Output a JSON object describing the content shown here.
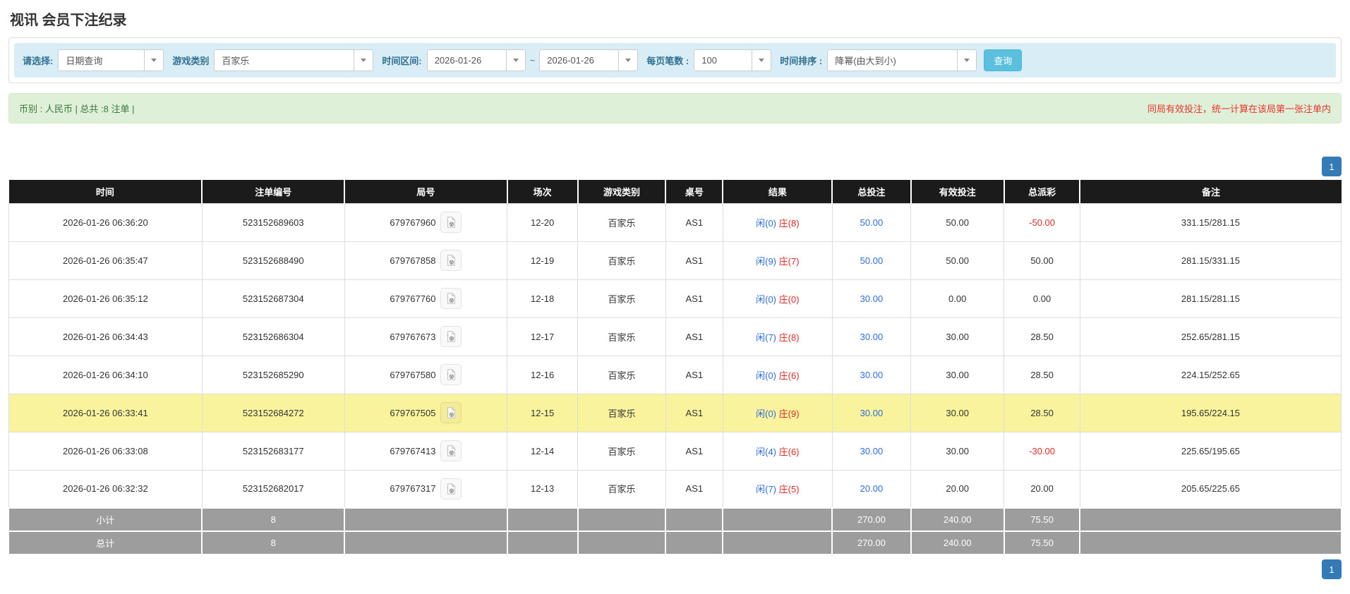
{
  "page": {
    "title": "视讯 会员下注纪录"
  },
  "filters": {
    "select_label": "请选择:",
    "select_value": "日期查询",
    "game_type_label": "游戏类别",
    "game_type_value": "百家乐",
    "time_range_label": "时间区间:",
    "date_from": "2026-01-26",
    "tilde": "~",
    "date_to": "2026-01-26",
    "page_size_label": "每页笔数 :",
    "page_size_value": "100",
    "sort_label": "时间排序 :",
    "sort_value": "降幂(由大到小)",
    "search_button": "查询"
  },
  "summary": {
    "left": "币别 : 人民币 | 总共 :8 注单 |",
    "right": "同局有效投注，统一计算在该局第一张注单内"
  },
  "pagination": {
    "page": "1"
  },
  "colors": {
    "header_bg": "#1b1b1b",
    "footer_bg": "#9d9d9d",
    "filter_bar_bg": "#d9edf7",
    "summary_bg": "#dff0d8",
    "highlight_row": "#f9f39d",
    "link_blue": "#2e6ddb",
    "result_red": "#e02a2a",
    "pagination_blue": "#337ab7",
    "search_button_bg": "#5bc0de",
    "warning_red": "#e9322d"
  },
  "table": {
    "headers": [
      "时间",
      "注单编号",
      "局号",
      "场次",
      "游戏类别",
      "桌号",
      "结果",
      "总投注",
      "有效投注",
      "总派彩",
      "备注"
    ],
    "rows": [
      {
        "time": "2026-01-26 06:36:20",
        "bet_id": "523152689603",
        "round_id": "679767960",
        "session": "12-20",
        "game": "百家乐",
        "table_no": "AS1",
        "player": "闲(0)",
        "banker": "庄(8)",
        "total_bet": "50.00",
        "valid_bet": "50.00",
        "payout": "-50.00",
        "remark": "331.15/281.15",
        "highlight": false
      },
      {
        "time": "2026-01-26 06:35:47",
        "bet_id": "523152688490",
        "round_id": "679767858",
        "session": "12-19",
        "game": "百家乐",
        "table_no": "AS1",
        "player": "闲(9)",
        "banker": "庄(7)",
        "total_bet": "50.00",
        "valid_bet": "50.00",
        "payout": "50.00",
        "remark": "281.15/331.15",
        "highlight": false
      },
      {
        "time": "2026-01-26 06:35:12",
        "bet_id": "523152687304",
        "round_id": "679767760",
        "session": "12-18",
        "game": "百家乐",
        "table_no": "AS1",
        "player": "闲(0)",
        "banker": "庄(0)",
        "total_bet": "30.00",
        "valid_bet": "0.00",
        "payout": "0.00",
        "remark": "281.15/281.15",
        "highlight": false
      },
      {
        "time": "2026-01-26 06:34:43",
        "bet_id": "523152686304",
        "round_id": "679767673",
        "session": "12-17",
        "game": "百家乐",
        "table_no": "AS1",
        "player": "闲(7)",
        "banker": "庄(8)",
        "total_bet": "30.00",
        "valid_bet": "30.00",
        "payout": "28.50",
        "remark": "252.65/281.15",
        "highlight": false
      },
      {
        "time": "2026-01-26 06:34:10",
        "bet_id": "523152685290",
        "round_id": "679767580",
        "session": "12-16",
        "game": "百家乐",
        "table_no": "AS1",
        "player": "闲(0)",
        "banker": "庄(6)",
        "total_bet": "30.00",
        "valid_bet": "30.00",
        "payout": "28.50",
        "remark": "224.15/252.65",
        "highlight": false
      },
      {
        "time": "2026-01-26 06:33:41",
        "bet_id": "523152684272",
        "round_id": "679767505",
        "session": "12-15",
        "game": "百家乐",
        "table_no": "AS1",
        "player": "闲(0)",
        "banker": "庄(9)",
        "total_bet": "30.00",
        "valid_bet": "30.00",
        "payout": "28.50",
        "remark": "195.65/224.15",
        "highlight": true
      },
      {
        "time": "2026-01-26 06:33:08",
        "bet_id": "523152683177",
        "round_id": "679767413",
        "session": "12-14",
        "game": "百家乐",
        "table_no": "AS1",
        "player": "闲(4)",
        "banker": "庄(6)",
        "total_bet": "30.00",
        "valid_bet": "30.00",
        "payout": "-30.00",
        "remark": "225.65/195.65",
        "highlight": false
      },
      {
        "time": "2026-01-26 06:32:32",
        "bet_id": "523152682017",
        "round_id": "679767317",
        "session": "12-13",
        "game": "百家乐",
        "table_no": "AS1",
        "player": "闲(7)",
        "banker": "庄(5)",
        "total_bet": "20.00",
        "valid_bet": "20.00",
        "payout": "20.00",
        "remark": "205.65/225.65",
        "highlight": false
      }
    ],
    "subtotal": {
      "label": "小计",
      "count": "8",
      "total_bet": "270.00",
      "valid_bet": "240.00",
      "payout": "75.50"
    },
    "total": {
      "label": "总计",
      "count": "8",
      "total_bet": "270.00",
      "valid_bet": "240.00",
      "payout": "75.50"
    }
  }
}
